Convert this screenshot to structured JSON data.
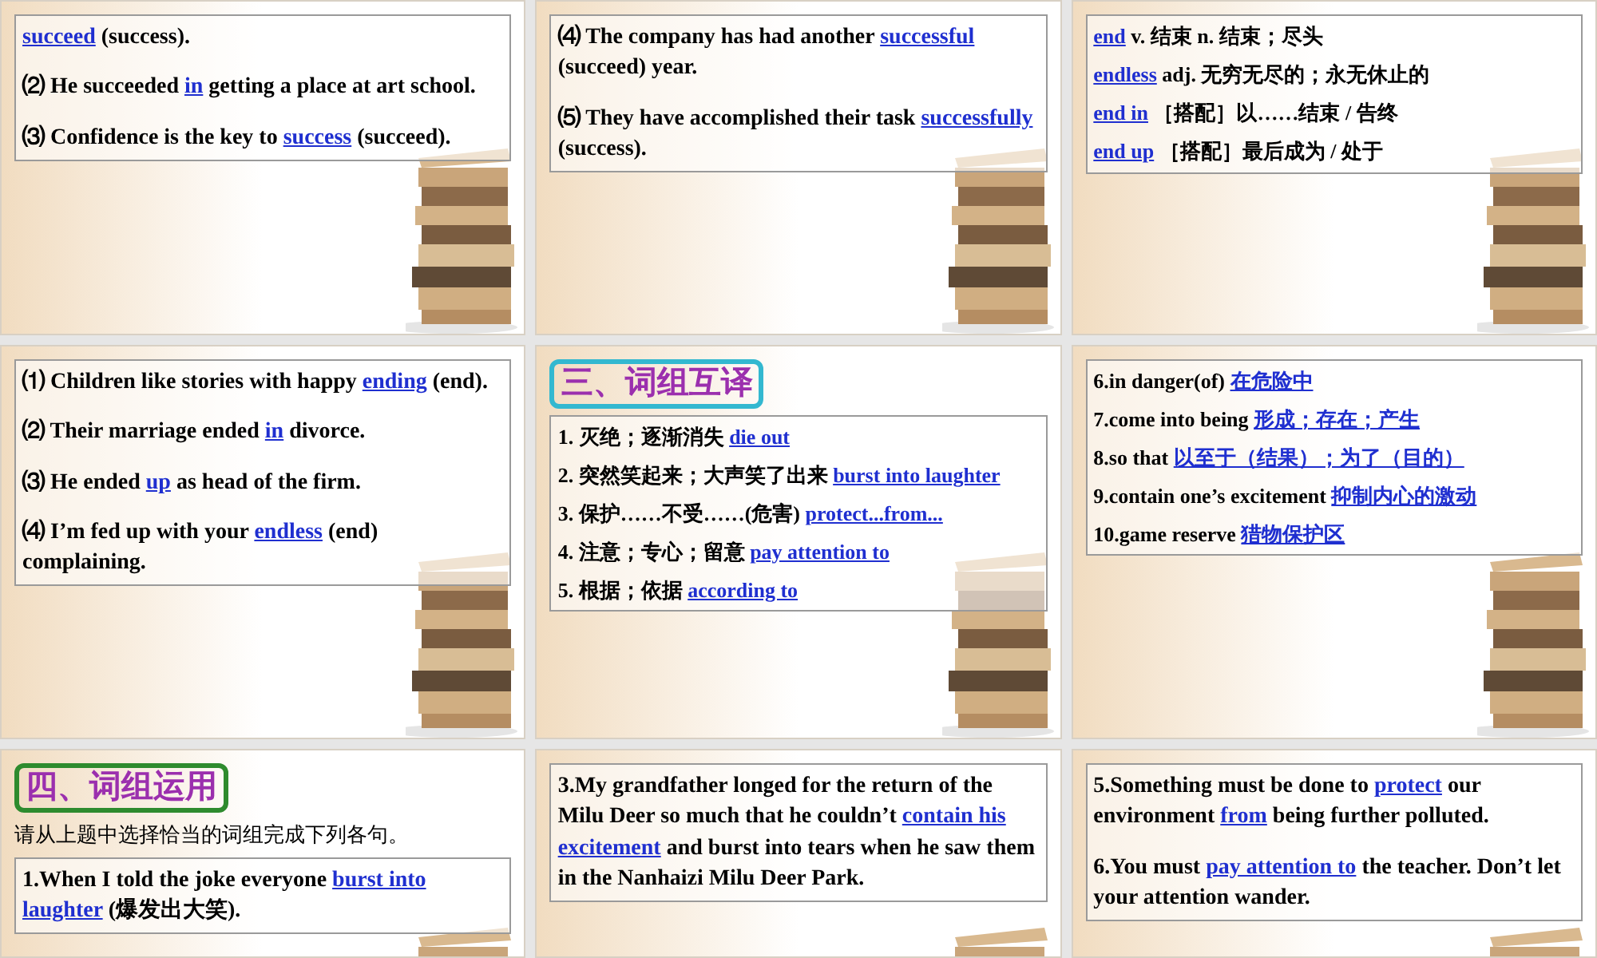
{
  "slides": [
    {
      "paragraphs": [
        {
          "segments": [
            {
              "text": "succeed",
              "kind": "answer"
            },
            {
              "text": " (success).",
              "kind": "plain"
            }
          ]
        },
        {
          "segments": [
            {
              "text": "⑵ He succeeded ",
              "kind": "plain"
            },
            {
              "text": "in",
              "kind": "answer"
            },
            {
              "text": " getting a place at art school.",
              "kind": "plain"
            }
          ]
        },
        {
          "segments": [
            {
              "text": "⑶ Confidence is the key to ",
              "kind": "plain"
            },
            {
              "text": "success",
              "kind": "answer"
            },
            {
              "text": " (succeed).",
              "kind": "plain"
            }
          ]
        }
      ]
    },
    {
      "paragraphs": [
        {
          "segments": [
            {
              "text": "⑷ The company has had another ",
              "kind": "plain"
            },
            {
              "text": "successful",
              "kind": "answer"
            },
            {
              "text": " (succeed) year.",
              "kind": "plain"
            }
          ]
        },
        {
          "segments": [
            {
              "text": "⑸ They have accomplished their task ",
              "kind": "plain"
            },
            {
              "text": "successfully",
              "kind": "answer"
            },
            {
              "text": " (success).",
              "kind": "plain"
            }
          ]
        }
      ]
    },
    {
      "paragraphs": [
        {
          "segments": [
            {
              "text": "end",
              "kind": "answer"
            },
            {
              "text": " v. 结束 n. 结束；尽头",
              "kind": "plain"
            }
          ]
        },
        {
          "segments": [
            {
              "text": "endless",
              "kind": "answer"
            },
            {
              "text": " adj. 无穷无尽的；永无休止的",
              "kind": "plain"
            }
          ]
        },
        {
          "segments": [
            {
              "text": "end in",
              "kind": "answer"
            },
            {
              "text": " ［搭配］以……结束 / 告终",
              "kind": "plain"
            }
          ]
        },
        {
          "segments": [
            {
              "text": "end up",
              "kind": "answer"
            },
            {
              "text": " ［搭配］最后成为 / 处于",
              "kind": "plain"
            }
          ]
        }
      ]
    },
    {
      "paragraphs": [
        {
          "segments": [
            {
              "text": "⑴ Children like stories with happy ",
              "kind": "plain"
            },
            {
              "text": "ending",
              "kind": "answer"
            },
            {
              "text": " (end).",
              "kind": "plain"
            }
          ]
        },
        {
          "segments": [
            {
              "text": "⑵ Their marriage ended ",
              "kind": "plain"
            },
            {
              "text": "in",
              "kind": "answer"
            },
            {
              "text": " divorce.",
              "kind": "plain"
            }
          ]
        },
        {
          "segments": [
            {
              "text": "⑶ He ended ",
              "kind": "plain"
            },
            {
              "text": "up",
              "kind": "answer"
            },
            {
              "text": " as head of the firm.",
              "kind": "plain"
            }
          ]
        },
        {
          "segments": [
            {
              "text": "⑷ I’m fed up with your ",
              "kind": "plain"
            },
            {
              "text": "endless",
              "kind": "answer"
            },
            {
              "text": " (end) complaining.",
              "kind": "plain"
            }
          ]
        }
      ]
    },
    {
      "heading": {
        "text": "三、词组互译",
        "kind": "translate"
      },
      "paragraphs": [
        {
          "segments": [
            {
              "text": "1. 灭绝；逐渐消失 ",
              "kind": "plain"
            },
            {
              "text": "die out",
              "kind": "answer"
            }
          ]
        },
        {
          "segments": [
            {
              "text": "2. 突然笑起来；大声笑了出来 ",
              "kind": "plain"
            },
            {
              "text": "burst into laughter",
              "kind": "answer"
            }
          ]
        },
        {
          "segments": [
            {
              "text": "3. 保护……不受……(危害) ",
              "kind": "plain"
            },
            {
              "text": "protect...from...",
              "kind": "answer"
            }
          ]
        },
        {
          "segments": [
            {
              "text": "4. 注意；专心；留意 ",
              "kind": "plain"
            },
            {
              "text": "pay attention to",
              "kind": "answer"
            }
          ]
        },
        {
          "segments": [
            {
              "text": "5. 根据；依据 ",
              "kind": "plain"
            },
            {
              "text": "according to",
              "kind": "answer"
            }
          ]
        }
      ]
    },
    {
      "paragraphs": [
        {
          "segments": [
            {
              "text": "6.in danger(of) ",
              "kind": "plain"
            },
            {
              "text": "在危险中",
              "kind": "answer"
            }
          ]
        },
        {
          "segments": [
            {
              "text": "7.come into being ",
              "kind": "plain"
            },
            {
              "text": "形成；存在；产生",
              "kind": "answer"
            }
          ]
        },
        {
          "segments": [
            {
              "text": "8.so that ",
              "kind": "plain"
            },
            {
              "text": "以至于（结果）；为了（目的）",
              "kind": "answer"
            }
          ]
        },
        {
          "segments": [
            {
              "text": "9.contain one’s excitement ",
              "kind": "plain"
            },
            {
              "text": "抑制内心的激动",
              "kind": "answer"
            }
          ]
        },
        {
          "segments": [
            {
              "text": "10.game reserve ",
              "kind": "plain"
            },
            {
              "text": "猎物保护区",
              "kind": "answer"
            }
          ]
        }
      ]
    },
    {
      "heading": {
        "text": "四、词组运用",
        "kind": "usage"
      },
      "instruction": "请从上题中选择恰当的词组完成下列各句。",
      "paragraphs": [
        {
          "segments": [
            {
              "text": "1.When I told the joke everyone ",
              "kind": "plain"
            },
            {
              "text": "burst into laughter",
              "kind": "answer"
            },
            {
              "text": " (爆发出大笑).",
              "kind": "plain"
            }
          ]
        }
      ]
    },
    {
      "paragraphs": [
        {
          "segments": [
            {
              "text": "3.My grandfather longed for the return of the Milu Deer so much that he couldn’t ",
              "kind": "plain"
            },
            {
              "text": "contain his excitement",
              "kind": "answer"
            },
            {
              "text": " and burst into tears when he saw them in the Nanhaizi Milu Deer Park.",
              "kind": "plain"
            }
          ]
        }
      ]
    },
    {
      "paragraphs": [
        {
          "segments": [
            {
              "text": "5.Something must be done to ",
              "kind": "plain"
            },
            {
              "text": "protect",
              "kind": "answer"
            },
            {
              "text": " our environment ",
              "kind": "plain"
            },
            {
              "text": "from",
              "kind": "answer"
            },
            {
              "text": " being further polluted.",
              "kind": "plain"
            }
          ]
        },
        {
          "segments": [
            {
              "text": "6.You must ",
              "kind": "plain"
            },
            {
              "text": "pay attention to",
              "kind": "answer"
            },
            {
              "text": " the teacher. Don’t let your attention wander.",
              "kind": "plain"
            }
          ]
        }
      ]
    }
  ]
}
